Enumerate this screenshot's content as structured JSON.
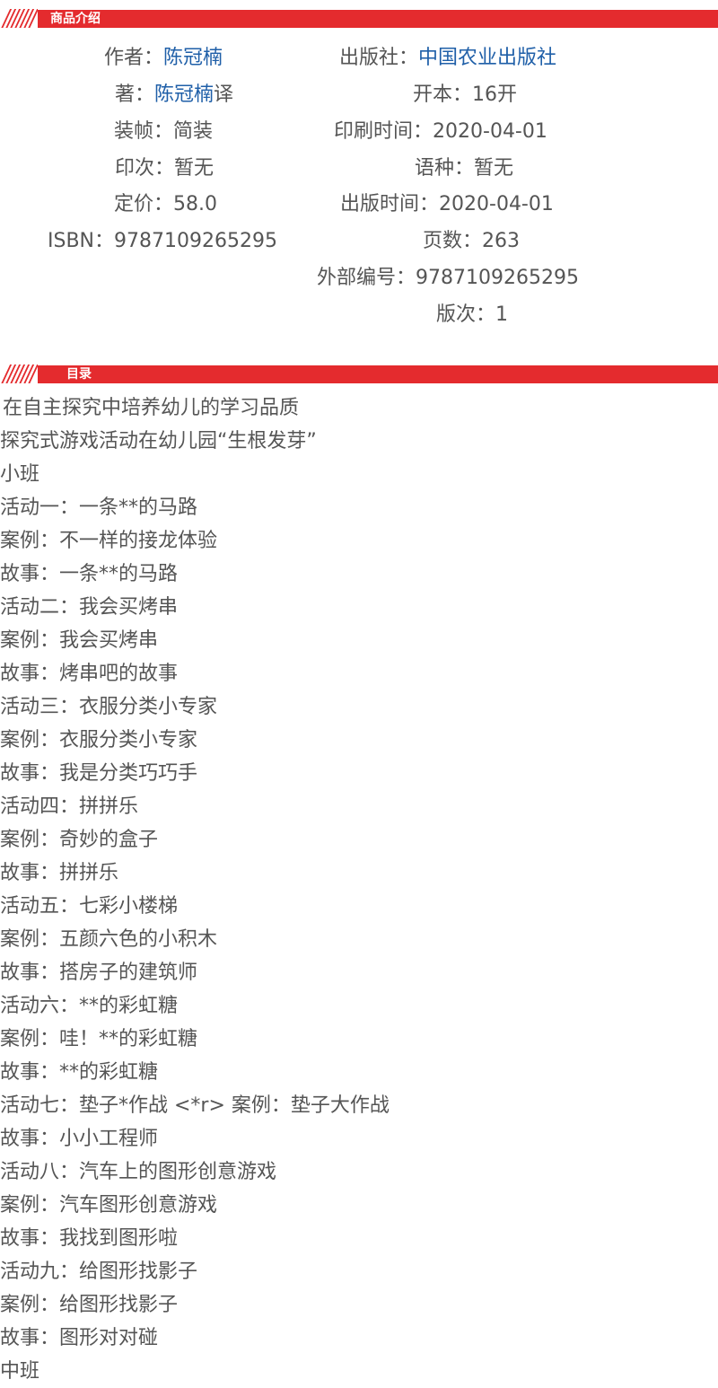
{
  "section_product": {
    "label": "商品介绍"
  },
  "info": {
    "author": {
      "key": "作者：",
      "val": "陈冠楠"
    },
    "publisher": {
      "key": "出版社：",
      "val": "中国农业出版社"
    },
    "writer": {
      "key": "著：",
      "val": "陈冠楠",
      "suffix": "译"
    },
    "format": {
      "key": "开本：",
      "val": "16开"
    },
    "binding": {
      "key": "装帧：",
      "val": "简装"
    },
    "print_time": {
      "key": "印刷时间：",
      "val": "2020-04-01"
    },
    "impression": {
      "key": "印次：",
      "val": "暂无"
    },
    "language": {
      "key": "语种：",
      "val": "暂无"
    },
    "price": {
      "key": "定价：",
      "val": "58.0"
    },
    "publish_time": {
      "key": "出版时间：",
      "val": "2020-04-01"
    },
    "isbn": {
      "key": "ISBN：",
      "val": "9787109265295"
    },
    "pages": {
      "key": "页数：",
      "val": "263"
    },
    "external_no": {
      "key": "外部编号：",
      "val": "9787109265295"
    },
    "edition": {
      "key": "版次：",
      "val": "1"
    }
  },
  "section_toc": {
    "label": "目录"
  },
  "toc": [
    " 在自主探究中培养幼儿的学习品质",
    "探究式游戏活动在幼儿园“生根发芽”",
    "小班",
    "活动一：一条**的马路",
    "案例：不一样的接龙体验",
    "故事：一条**的马路",
    "活动二：我会买烤串",
    "案例：我会买烤串",
    "故事：烤串吧的故事",
    "活动三：衣服分类小专家",
    "案例：衣服分类小专家",
    "故事：我是分类巧巧手",
    "活动四：拼拼乐",
    "案例：奇妙的盒子",
    "故事：拼拼乐",
    "活动五：七彩小楼梯",
    "案例：五颜六色的小积木",
    "故事：搭房子的建筑师",
    "活动六：**的彩虹糖",
    "案例：哇！**的彩虹糖",
    "故事：**的彩虹糖",
    "活动七：垫子*作战 <*r> 案例：垫子大作战",
    "故事：小小工程师",
    "活动八：汽车上的图形创意游戏",
    "案例：汽车图形创意游戏",
    "故事：我找到图形啦",
    "活动九：给图形找影子",
    "案例：给图形找影子",
    "故事：图形对对碰",
    "中班"
  ],
  "colors": {
    "accent": "#e42b2e",
    "link": "#1f5fa8",
    "text": "#555555"
  }
}
